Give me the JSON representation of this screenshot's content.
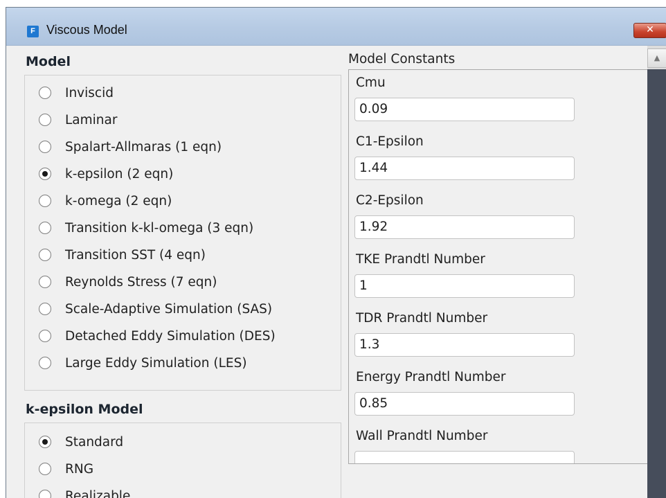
{
  "window": {
    "title": "Viscous Model",
    "app_icon_letter": "F",
    "close_glyph": "✕"
  },
  "model": {
    "heading": "Model",
    "options": [
      {
        "label": "Inviscid",
        "selected": false
      },
      {
        "label": "Laminar",
        "selected": false
      },
      {
        "label": "Spalart-Allmaras (1 eqn)",
        "selected": false
      },
      {
        "label": "k-epsilon (2 eqn)",
        "selected": true
      },
      {
        "label": "k-omega (2 eqn)",
        "selected": false
      },
      {
        "label": "Transition k-kl-omega (3 eqn)",
        "selected": false
      },
      {
        "label": "Transition SST (4 eqn)",
        "selected": false
      },
      {
        "label": "Reynolds Stress (7 eqn)",
        "selected": false
      },
      {
        "label": "Scale-Adaptive Simulation (SAS)",
        "selected": false
      },
      {
        "label": "Detached Eddy Simulation (DES)",
        "selected": false
      },
      {
        "label": "Large Eddy Simulation (LES)",
        "selected": false
      }
    ]
  },
  "kepsilon_model": {
    "heading": "k-epsilon Model",
    "options": [
      {
        "label": "Standard",
        "selected": true
      },
      {
        "label": "RNG",
        "selected": false
      },
      {
        "label": "Realizable",
        "selected": false
      }
    ]
  },
  "model_constants": {
    "heading": "Model Constants",
    "items": [
      {
        "label": "Cmu",
        "value": "0.09"
      },
      {
        "label": "C1-Epsilon",
        "value": "1.44"
      },
      {
        "label": "C2-Epsilon",
        "value": "1.92"
      },
      {
        "label": "TKE Prandtl Number",
        "value": "1"
      },
      {
        "label": "TDR Prandtl Number",
        "value": "1.3"
      },
      {
        "label": "Energy Prandtl Number",
        "value": "0.85"
      },
      {
        "label": "Wall Prandtl Number",
        "value": ""
      }
    ]
  },
  "scrollbar": {
    "up_glyph": "▲"
  }
}
